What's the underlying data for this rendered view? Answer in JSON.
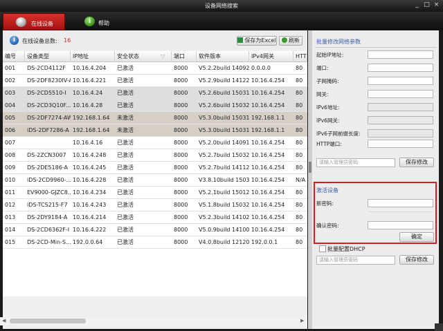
{
  "window": {
    "title": "设备网络搜索",
    "min": "_",
    "max": "□",
    "close": "×"
  },
  "tabs": [
    {
      "label": "在线设备"
    },
    {
      "label": "帮助"
    }
  ],
  "summary": {
    "label": "在线设备总数:",
    "count": "16"
  },
  "toolbar": {
    "export": "保存为Excel",
    "refresh": "刷新"
  },
  "columns": [
    "编号",
    "设备类型",
    "IP地址",
    "安全状态",
    "端口",
    "软件版本",
    "IPv4网关",
    "HTT"
  ],
  "rows": [
    [
      "001",
      "DS-2CD4112F",
      "10.16.4.204",
      "已激活",
      "8000",
      "V5.2.2build 140928",
      "0.0.0.0",
      "80"
    ],
    [
      "002",
      "DS-2DF8230IV-A",
      "10.16.4.221",
      "已激活",
      "8000",
      "V5.2.9build 141222",
      "10.16.4.254",
      "80"
    ],
    [
      "003",
      "DS-2CD5510-I",
      "10.16.4.24",
      "已激活",
      "8000",
      "V5.2.6build 150316",
      "10.16.4.254",
      "80"
    ],
    [
      "004",
      "DS-2CD3Q10F...",
      "10.16.4.28",
      "已激活",
      "8000",
      "V5.2.6build 150327",
      "10.16.4.254",
      "80"
    ],
    [
      "005",
      "DS-2DF7274-AW",
      "192.168.1.64",
      "未激活",
      "8000",
      "V5.3.0build 150319",
      "192.168.1.1",
      "80"
    ],
    [
      "006",
      "iDS-2DF7286-A",
      "192.168.1.64",
      "未激活",
      "8000",
      "V5.3.0build 150319",
      "192.168.1.1",
      "80"
    ],
    [
      "007",
      "",
      "10.16.4.16",
      "已激活",
      "8000",
      "V5.2.0build 140915",
      "10.16.4.254",
      "80"
    ],
    [
      "008",
      "DS-2ZCN3007",
      "10.16.4.248",
      "已激活",
      "8000",
      "V5.2.7build 150325",
      "10.16.4.254",
      "80"
    ],
    [
      "009",
      "DS-2DE5186-A",
      "10.16.4.245",
      "已激活",
      "8000",
      "V5.2.7build 141125",
      "10.16.4.254",
      "80"
    ],
    [
      "010",
      "iDS-2CD9960-...",
      "10.16.4.228",
      "已激活",
      "8000",
      "V3.8.10build 150326",
      "10.16.4.254",
      "N/A"
    ],
    [
      "011",
      "EV9000-GJZC8...",
      "10.16.4.234",
      "已激活",
      "8000",
      "V5.2.1build 150121",
      "10.16.4.254",
      "80"
    ],
    [
      "012",
      "iDS-TCS215-F7",
      "10.16.4.243",
      "已激活",
      "8000",
      "V5.1.8build 150323",
      "10.16.4.254",
      "80"
    ],
    [
      "013",
      "DS-2DY9184-A",
      "10.16.4.214",
      "已激活",
      "8000",
      "V5.2.3build 141022",
      "10.16.4.254",
      "80"
    ],
    [
      "014",
      "DS-2CD6362F-I",
      "10.16.4.222",
      "已激活",
      "8000",
      "V5.0.9build 141009",
      "10.16.4.254",
      "80"
    ],
    [
      "015",
      "DS-2CD-Min-S...",
      "192.0.0.64",
      "已激活",
      "8000",
      "V4.0.8build 121206",
      "192.0.0.1",
      "80"
    ]
  ],
  "batch": {
    "title": "批量修改网络参数",
    "fields": [
      "起始IP地址:",
      "端口:",
      "子网掩码:",
      "网关:",
      "IPv6地址:",
      "IPv6网关:",
      "IPv6子网前缀长度:",
      "HTTP端口:"
    ],
    "pwd_placeholder": "请输入管理员密码",
    "save": "保存修改"
  },
  "activate": {
    "title": "激活设备",
    "new_pwd": "新密码:",
    "confirm_pwd": "确认密码:",
    "ok": "确定"
  },
  "dhcp": {
    "label": "批量配置DHCP",
    "pwd_placeholder": "请输入管理员密码",
    "save": "保存修改"
  }
}
